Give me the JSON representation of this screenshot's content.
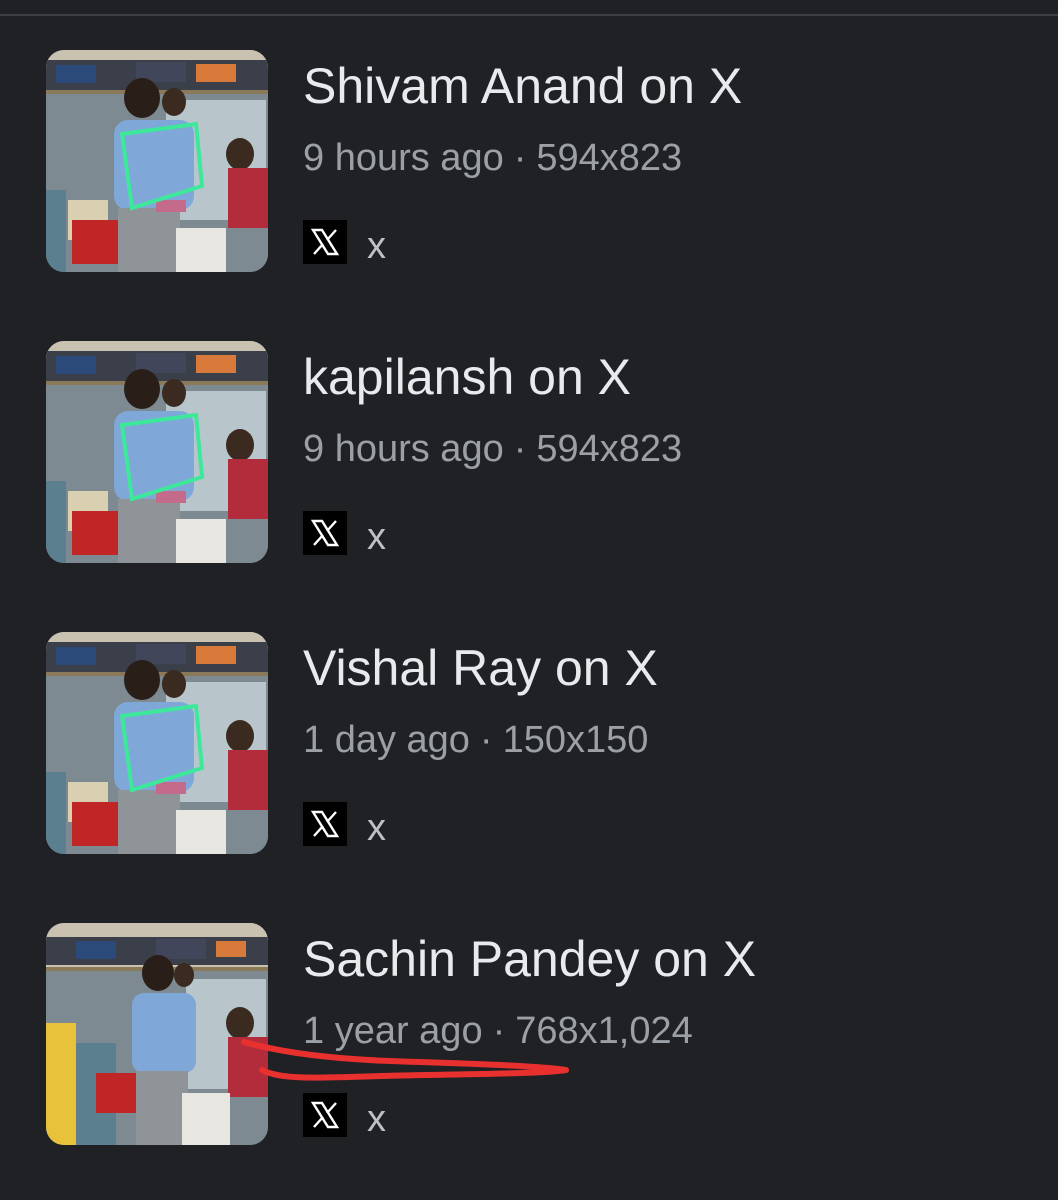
{
  "results": [
    {
      "title": "Shivam Anand on X",
      "time": "9 hours ago",
      "separator": "·",
      "dimensions": "594x823",
      "source_label": "x",
      "source_icon": "x-logo-icon",
      "thumbnail_highlight": true
    },
    {
      "title": "kapilansh on X",
      "time": "9 hours ago",
      "separator": "·",
      "dimensions": "594x823",
      "source_label": "x",
      "source_icon": "x-logo-icon",
      "thumbnail_highlight": true
    },
    {
      "title": "Vishal Ray on X",
      "time": "1 day ago",
      "separator": "·",
      "dimensions": "150x150",
      "source_label": "x",
      "source_icon": "x-logo-icon",
      "thumbnail_highlight": true
    },
    {
      "title": "Sachin Pandey on X",
      "time": "1 year ago",
      "separator": "·",
      "dimensions": "768x1,024",
      "source_label": "x",
      "source_icon": "x-logo-icon",
      "thumbnail_highlight": false
    }
  ],
  "colors": {
    "background": "#202124",
    "title": "#e8eaed",
    "meta": "#9aa0a6",
    "highlight_outline": "#3ee89a",
    "annotation_underline": "#e8302f"
  }
}
